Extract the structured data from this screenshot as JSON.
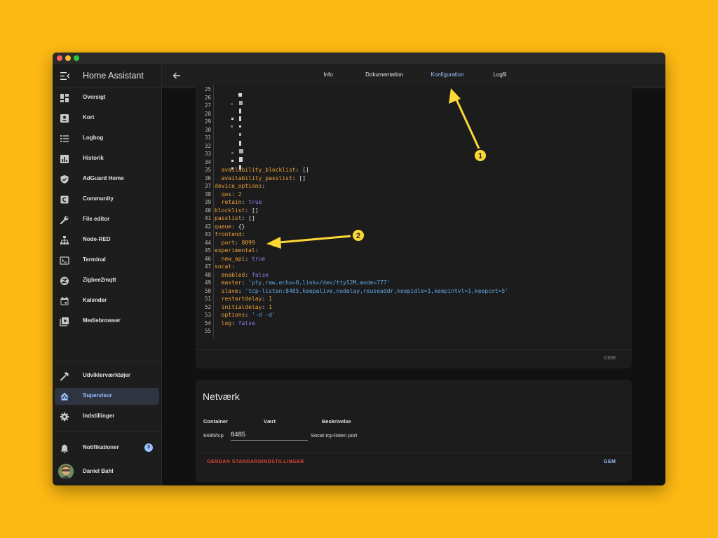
{
  "app": {
    "title": "Home Assistant"
  },
  "sidebar": {
    "items": [
      {
        "label": "Oversigt",
        "icon": "dashboard-icon"
      },
      {
        "label": "Kort",
        "icon": "map-icon"
      },
      {
        "label": "Logbog",
        "icon": "logbook-icon"
      },
      {
        "label": "Historik",
        "icon": "history-icon"
      },
      {
        "label": "AdGuard Home",
        "icon": "shield-icon"
      },
      {
        "label": "Community",
        "icon": "community-icon"
      },
      {
        "label": "File editor",
        "icon": "wrench-icon"
      },
      {
        "label": "Node-RED",
        "icon": "sitemap-icon"
      },
      {
        "label": "Terminal",
        "icon": "terminal-icon"
      },
      {
        "label": "Zigbee2mqtt",
        "icon": "zigbee-icon"
      },
      {
        "label": "Kalender",
        "icon": "calendar-icon"
      },
      {
        "label": "Mediebrowser",
        "icon": "play-box-icon"
      }
    ],
    "bottom_items": [
      {
        "label": "Udviklerværktøjer",
        "icon": "hammer-icon"
      },
      {
        "label": "Supervisor",
        "icon": "supervisor-icon",
        "active": true
      },
      {
        "label": "Indstillinger",
        "icon": "gear-icon"
      }
    ],
    "notifications": {
      "label": "Notifikationer",
      "count": "3"
    },
    "user": {
      "name": "Daniel Bahl"
    }
  },
  "tabs": [
    {
      "label": "Info"
    },
    {
      "label": "Dokumentation"
    },
    {
      "label": "Konfiguration",
      "active": true
    },
    {
      "label": "Logfil"
    }
  ],
  "editor": {
    "lines": [
      {
        "n": "25",
        "t": ""
      },
      {
        "n": "26",
        "t": ""
      },
      {
        "n": "27",
        "t": ""
      },
      {
        "n": "28",
        "t": ""
      },
      {
        "n": "29",
        "t": ""
      },
      {
        "n": "30",
        "t": ""
      },
      {
        "n": "31",
        "t": ""
      },
      {
        "n": "32",
        "t": ""
      },
      {
        "n": "33",
        "t": ""
      },
      {
        "n": "34",
        "t": ""
      },
      {
        "n": "35",
        "t": "  availability_blocklist: []"
      },
      {
        "n": "36",
        "t": "  availability_passlist: []"
      },
      {
        "n": "37",
        "t": "device_options:"
      },
      {
        "n": "38",
        "t": "  qos: 2"
      },
      {
        "n": "39",
        "t": "  retain: true"
      },
      {
        "n": "40",
        "t": "blocklist: []"
      },
      {
        "n": "41",
        "t": "passlist: []"
      },
      {
        "n": "42",
        "t": "queue: {}"
      },
      {
        "n": "43",
        "t": "frontend:"
      },
      {
        "n": "44",
        "t": "  port: 8099"
      },
      {
        "n": "45",
        "t": "experimental:"
      },
      {
        "n": "46",
        "t": "  new_api: true"
      },
      {
        "n": "47",
        "t": "socat:"
      },
      {
        "n": "48",
        "t": "  enabled: false"
      },
      {
        "n": "49",
        "t": "  master: 'pty,raw,echo=0,link=/dev/ttyS2M,mode=777'"
      },
      {
        "n": "50",
        "t": "  slave: 'tcp-listen:8485,keepalive,nodelay,reuseaddr,keepidle=1,keepintvl=1,keepcnt=5'"
      },
      {
        "n": "51",
        "t": "  restartdelay: 1"
      },
      {
        "n": "52",
        "t": "  initialdelay: 1"
      },
      {
        "n": "53",
        "t": "  options: '-d -d'"
      },
      {
        "n": "54",
        "t": "  log: false"
      },
      {
        "n": "55",
        "t": ""
      }
    ],
    "save_label": "GEM"
  },
  "network": {
    "title": "Netværk",
    "columns": [
      "Container",
      "Vært",
      "Beskrivelse"
    ],
    "row": {
      "container": "8485/tcp",
      "host": "8485",
      "description": "Socat tcp-listen port"
    },
    "reset_label": "GENDAN STANDARDINDSTILLINGER",
    "save_label": "GEM"
  },
  "callouts": [
    "1",
    "2"
  ],
  "colors": {
    "accent": "#9ac2ff",
    "background": "#fdb913",
    "callout": "#fdd835",
    "reset": "#db4437"
  }
}
